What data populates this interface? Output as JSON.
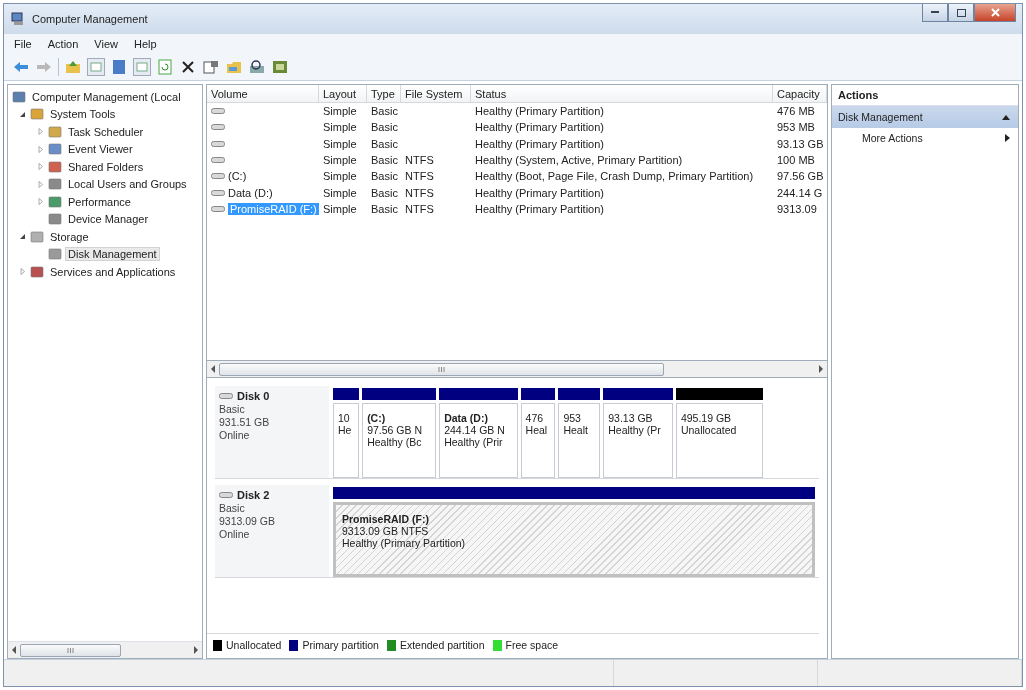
{
  "window": {
    "title": "Computer Management"
  },
  "menu": [
    "File",
    "Action",
    "View",
    "Help"
  ],
  "tree": [
    {
      "label": "Computer Management (Local",
      "selected": false,
      "children": [
        {
          "label": "System Tools",
          "selected": false,
          "expanded": true,
          "children": [
            {
              "label": "Task Scheduler",
              "selected": false,
              "expanded": false
            },
            {
              "label": "Event Viewer",
              "selected": false,
              "expanded": false
            },
            {
              "label": "Shared Folders",
              "selected": false,
              "expanded": false
            },
            {
              "label": "Local Users and Groups",
              "selected": false,
              "expanded": false
            },
            {
              "label": "Performance",
              "selected": false,
              "expanded": false
            },
            {
              "label": "Device Manager",
              "selected": false
            }
          ]
        },
        {
          "label": "Storage",
          "selected": false,
          "expanded": true,
          "children": [
            {
              "label": "Disk Management",
              "selected": true
            }
          ]
        },
        {
          "label": "Services and Applications",
          "selected": false,
          "expanded": false
        }
      ]
    }
  ],
  "table": {
    "columns": [
      "Volume",
      "Layout",
      "Type",
      "File System",
      "Status",
      "Capacity"
    ],
    "rows": [
      {
        "layout": "Simple",
        "type": "Basic",
        "status": "Healthy (Primary Partition)",
        "capacity": "476 MB",
        "selected": false
      },
      {
        "layout": "Simple",
        "type": "Basic",
        "status": "Healthy (Primary Partition)",
        "capacity": "953 MB",
        "selected": false
      },
      {
        "layout": "Simple",
        "type": "Basic",
        "status": "Healthy (Primary Partition)",
        "capacity": "93.13 GB",
        "selected": false
      },
      {
        "layout": "Simple",
        "type": "Basic",
        "file_system": "NTFS",
        "status": "Healthy (System, Active, Primary Partition)",
        "capacity": "100 MB",
        "selected": false
      },
      {
        "volume": "(C:)",
        "layout": "Simple",
        "type": "Basic",
        "file_system": "NTFS",
        "status": "Healthy (Boot, Page File, Crash Dump, Primary Partition)",
        "capacity": "97.56 GB",
        "selected": false
      },
      {
        "volume": "Data (D:)",
        "layout": "Simple",
        "type": "Basic",
        "file_system": "NTFS",
        "status": "Healthy (Primary Partition)",
        "capacity": "244.14 G",
        "selected": false
      },
      {
        "volume": "PromiseRAID (F:)",
        "layout": "Simple",
        "type": "Basic",
        "file_system": "NTFS",
        "status": "Healthy (Primary Partition)",
        "capacity": "9313.09",
        "selected": true
      }
    ]
  },
  "disks": [
    {
      "name": "Disk 0",
      "type": "Basic",
      "size": "931.51 GB",
      "state": "Online",
      "partitions": [
        {
          "color": "#000080",
          "detail": "10",
          "status": "He",
          "selected": false
        },
        {
          "color": "#000080",
          "name": "(C:)",
          "detail": "97.56 GB N",
          "status": "Healthy (Bc",
          "selected": false
        },
        {
          "color": "#000080",
          "name": "Data  (D:)",
          "detail": "244.14 GB N",
          "status": "Healthy (Prir",
          "selected": false
        },
        {
          "color": "#000080",
          "detail": "476",
          "status": "Heal",
          "selected": false
        },
        {
          "color": "#000080",
          "detail": "953",
          "status": "Healt",
          "selected": false
        },
        {
          "color": "#000080",
          "detail": "93.13 GB",
          "status": "Healthy (Pr",
          "selected": false
        },
        {
          "color": "#000000",
          "detail": "495.19 GB",
          "status": "Unallocated",
          "selected": false
        }
      ]
    },
    {
      "name": "Disk 2",
      "type": "Basic",
      "size": "9313.09 GB",
      "state": "Online",
      "partitions": [
        {
          "color": "#000080",
          "name": "PromiseRAID  (F:)",
          "detail": "9313.09 GB NTFS",
          "status": "Healthy (Primary Partition)",
          "selected": true
        }
      ]
    }
  ],
  "legend": [
    {
      "label": "Unallocated",
      "color": "#000000"
    },
    {
      "label": "Primary partition",
      "color": "#000080"
    },
    {
      "label": "Extended partition",
      "color": "#228b22"
    },
    {
      "label": "Free space",
      "color": "#33dd33"
    }
  ],
  "actions": {
    "title": "Actions",
    "sections": [
      {
        "label": "Disk Management",
        "expanded": true,
        "items": [
          "More Actions"
        ]
      }
    ]
  }
}
